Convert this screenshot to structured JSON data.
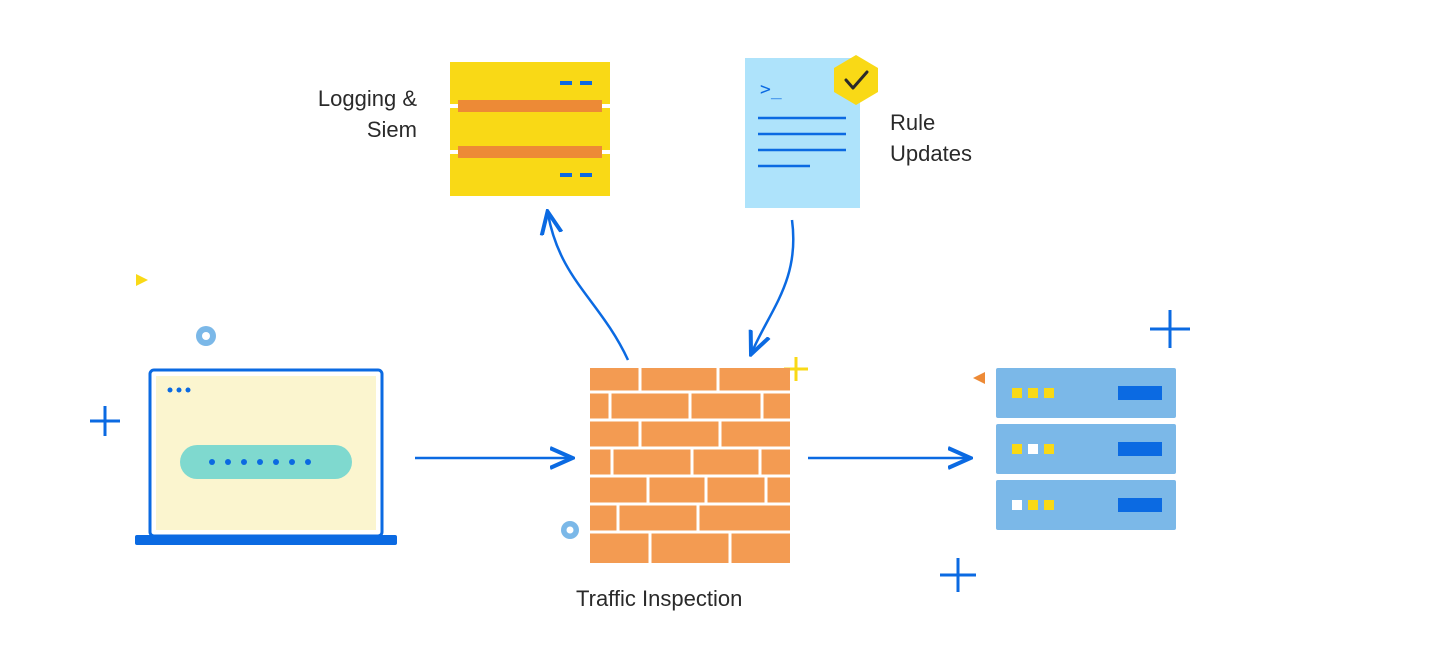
{
  "diagram": {
    "labels": {
      "logging_siem": "Logging &\nSiem",
      "rule_updates": "Rule\nUpdates",
      "traffic_inspection": "Traffic Inspection"
    },
    "nodes": {
      "client": "Laptop / Client",
      "firewall": "Brick Wall Firewall — Traffic Inspection",
      "logging": "Logging & SIEM storage",
      "rules": "Rule Updates document",
      "servers": "Backend server rack"
    },
    "flows": [
      {
        "from": "client",
        "to": "firewall",
        "dir": "right"
      },
      {
        "from": "firewall",
        "to": "servers",
        "dir": "right"
      },
      {
        "from": "firewall",
        "to": "logging",
        "dir": "up"
      },
      {
        "from": "rules",
        "to": "firewall",
        "dir": "down"
      }
    ],
    "colors": {
      "blue": "#0B6AE2",
      "lightblue": "#7BB8E8",
      "skyblue": "#AEE3FB",
      "yellow": "#F9D916",
      "orange": "#F39B52",
      "darkorange": "#ED8A36",
      "teal": "#7FD9CF",
      "cream": "#FBF5CF",
      "text": "#2a2a2a"
    }
  }
}
